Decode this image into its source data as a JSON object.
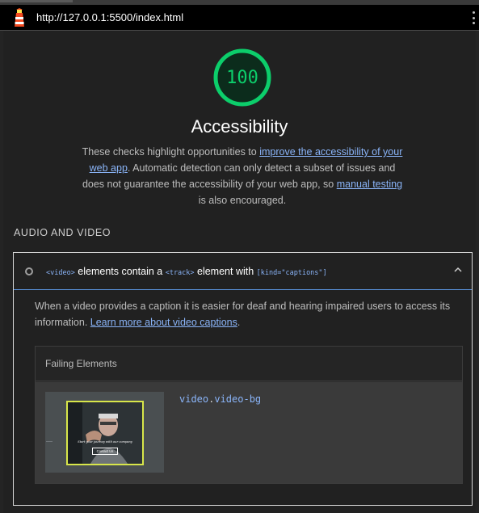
{
  "browser": {
    "url": "http://127.0.0.1:5500/index.html",
    "logo_icon": "lighthouse-icon",
    "menu_icon": "kebab-menu-icon"
  },
  "category": {
    "score": "100",
    "score_color": "#0cce6b",
    "title": "Accessibility",
    "description_part1": "These checks highlight opportunities to ",
    "description_link1": "improve the accessibility of your web app",
    "description_part2": ". Automatic detection can only detect a subset of issues and does not guarantee the accessibility of your web app, so ",
    "description_link2": "manual testing",
    "description_part3": " is also encouraged."
  },
  "group": {
    "title": "AUDIO AND VIDEO"
  },
  "audit": {
    "title_code1": "<video>",
    "title_text1": " elements contain a ",
    "title_code2": "<track>",
    "title_text2": " element with ",
    "title_code3": "[kind=\"captions\"]",
    "description": "When a video provides a caption it is easier for deaf and hearing impaired users to access its information. ",
    "learn_more": "Learn more about video captions",
    "description_end": ".",
    "failing_header": "Failing Elements",
    "element_tag": "video",
    "element_dot": ".",
    "element_class": "video-bg",
    "thumbnail_caption": "Start your journey with our company",
    "thumbnail_button": "Contact Us"
  },
  "colors": {
    "link": "#8ab4f8",
    "pass_green": "#0cce6b",
    "highlight_outline": "#d8e64a"
  }
}
